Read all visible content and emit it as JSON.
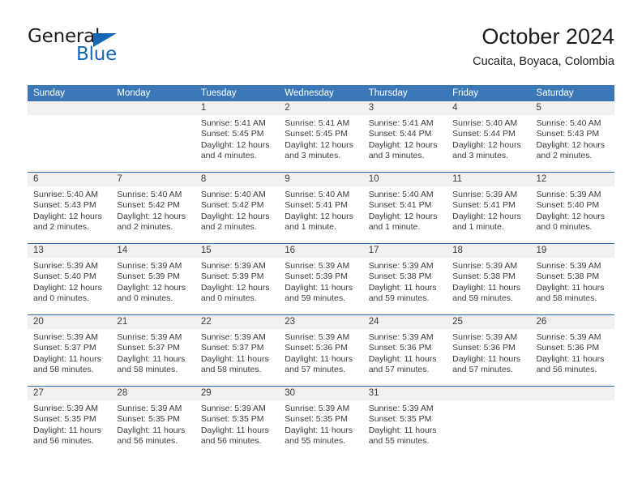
{
  "brand": {
    "name_part1": "General",
    "name_part2": "Blue",
    "accent_color": "#1667b3"
  },
  "header": {
    "month_title": "October 2024",
    "location": "Cucaita, Boyaca, Colombia"
  },
  "calendar": {
    "header_color": "#3b78b8",
    "row_divider_color": "#2d6ca8",
    "day_band_color": "#f0f0f0",
    "weekdays": [
      "Sunday",
      "Monday",
      "Tuesday",
      "Wednesday",
      "Thursday",
      "Friday",
      "Saturday"
    ],
    "weeks": [
      [
        {
          "day": "",
          "lines": []
        },
        {
          "day": "",
          "lines": []
        },
        {
          "day": "1",
          "lines": [
            "Sunrise: 5:41 AM",
            "Sunset: 5:45 PM",
            "Daylight: 12 hours",
            "and 4 minutes."
          ]
        },
        {
          "day": "2",
          "lines": [
            "Sunrise: 5:41 AM",
            "Sunset: 5:45 PM",
            "Daylight: 12 hours",
            "and 3 minutes."
          ]
        },
        {
          "day": "3",
          "lines": [
            "Sunrise: 5:41 AM",
            "Sunset: 5:44 PM",
            "Daylight: 12 hours",
            "and 3 minutes."
          ]
        },
        {
          "day": "4",
          "lines": [
            "Sunrise: 5:40 AM",
            "Sunset: 5:44 PM",
            "Daylight: 12 hours",
            "and 3 minutes."
          ]
        },
        {
          "day": "5",
          "lines": [
            "Sunrise: 5:40 AM",
            "Sunset: 5:43 PM",
            "Daylight: 12 hours",
            "and 2 minutes."
          ]
        }
      ],
      [
        {
          "day": "6",
          "lines": [
            "Sunrise: 5:40 AM",
            "Sunset: 5:43 PM",
            "Daylight: 12 hours",
            "and 2 minutes."
          ]
        },
        {
          "day": "7",
          "lines": [
            "Sunrise: 5:40 AM",
            "Sunset: 5:42 PM",
            "Daylight: 12 hours",
            "and 2 minutes."
          ]
        },
        {
          "day": "8",
          "lines": [
            "Sunrise: 5:40 AM",
            "Sunset: 5:42 PM",
            "Daylight: 12 hours",
            "and 2 minutes."
          ]
        },
        {
          "day": "9",
          "lines": [
            "Sunrise: 5:40 AM",
            "Sunset: 5:41 PM",
            "Daylight: 12 hours",
            "and 1 minute."
          ]
        },
        {
          "day": "10",
          "lines": [
            "Sunrise: 5:40 AM",
            "Sunset: 5:41 PM",
            "Daylight: 12 hours",
            "and 1 minute."
          ]
        },
        {
          "day": "11",
          "lines": [
            "Sunrise: 5:39 AM",
            "Sunset: 5:41 PM",
            "Daylight: 12 hours",
            "and 1 minute."
          ]
        },
        {
          "day": "12",
          "lines": [
            "Sunrise: 5:39 AM",
            "Sunset: 5:40 PM",
            "Daylight: 12 hours",
            "and 0 minutes."
          ]
        }
      ],
      [
        {
          "day": "13",
          "lines": [
            "Sunrise: 5:39 AM",
            "Sunset: 5:40 PM",
            "Daylight: 12 hours",
            "and 0 minutes."
          ]
        },
        {
          "day": "14",
          "lines": [
            "Sunrise: 5:39 AM",
            "Sunset: 5:39 PM",
            "Daylight: 12 hours",
            "and 0 minutes."
          ]
        },
        {
          "day": "15",
          "lines": [
            "Sunrise: 5:39 AM",
            "Sunset: 5:39 PM",
            "Daylight: 12 hours",
            "and 0 minutes."
          ]
        },
        {
          "day": "16",
          "lines": [
            "Sunrise: 5:39 AM",
            "Sunset: 5:39 PM",
            "Daylight: 11 hours",
            "and 59 minutes."
          ]
        },
        {
          "day": "17",
          "lines": [
            "Sunrise: 5:39 AM",
            "Sunset: 5:38 PM",
            "Daylight: 11 hours",
            "and 59 minutes."
          ]
        },
        {
          "day": "18",
          "lines": [
            "Sunrise: 5:39 AM",
            "Sunset: 5:38 PM",
            "Daylight: 11 hours",
            "and 59 minutes."
          ]
        },
        {
          "day": "19",
          "lines": [
            "Sunrise: 5:39 AM",
            "Sunset: 5:38 PM",
            "Daylight: 11 hours",
            "and 58 minutes."
          ]
        }
      ],
      [
        {
          "day": "20",
          "lines": [
            "Sunrise: 5:39 AM",
            "Sunset: 5:37 PM",
            "Daylight: 11 hours",
            "and 58 minutes."
          ]
        },
        {
          "day": "21",
          "lines": [
            "Sunrise: 5:39 AM",
            "Sunset: 5:37 PM",
            "Daylight: 11 hours",
            "and 58 minutes."
          ]
        },
        {
          "day": "22",
          "lines": [
            "Sunrise: 5:39 AM",
            "Sunset: 5:37 PM",
            "Daylight: 11 hours",
            "and 58 minutes."
          ]
        },
        {
          "day": "23",
          "lines": [
            "Sunrise: 5:39 AM",
            "Sunset: 5:36 PM",
            "Daylight: 11 hours",
            "and 57 minutes."
          ]
        },
        {
          "day": "24",
          "lines": [
            "Sunrise: 5:39 AM",
            "Sunset: 5:36 PM",
            "Daylight: 11 hours",
            "and 57 minutes."
          ]
        },
        {
          "day": "25",
          "lines": [
            "Sunrise: 5:39 AM",
            "Sunset: 5:36 PM",
            "Daylight: 11 hours",
            "and 57 minutes."
          ]
        },
        {
          "day": "26",
          "lines": [
            "Sunrise: 5:39 AM",
            "Sunset: 5:36 PM",
            "Daylight: 11 hours",
            "and 56 minutes."
          ]
        }
      ],
      [
        {
          "day": "27",
          "lines": [
            "Sunrise: 5:39 AM",
            "Sunset: 5:35 PM",
            "Daylight: 11 hours",
            "and 56 minutes."
          ]
        },
        {
          "day": "28",
          "lines": [
            "Sunrise: 5:39 AM",
            "Sunset: 5:35 PM",
            "Daylight: 11 hours",
            "and 56 minutes."
          ]
        },
        {
          "day": "29",
          "lines": [
            "Sunrise: 5:39 AM",
            "Sunset: 5:35 PM",
            "Daylight: 11 hours",
            "and 56 minutes."
          ]
        },
        {
          "day": "30",
          "lines": [
            "Sunrise: 5:39 AM",
            "Sunset: 5:35 PM",
            "Daylight: 11 hours",
            "and 55 minutes."
          ]
        },
        {
          "day": "31",
          "lines": [
            "Sunrise: 5:39 AM",
            "Sunset: 5:35 PM",
            "Daylight: 11 hours",
            "and 55 minutes."
          ]
        },
        {
          "day": "",
          "lines": []
        },
        {
          "day": "",
          "lines": []
        }
      ]
    ]
  }
}
